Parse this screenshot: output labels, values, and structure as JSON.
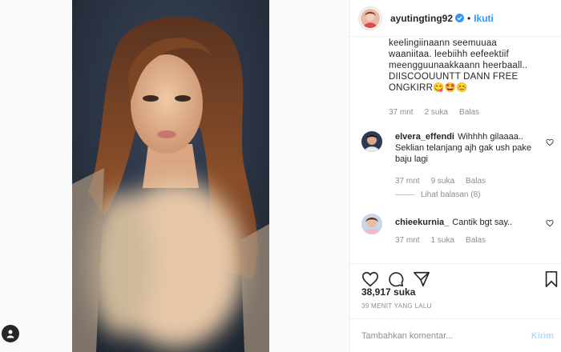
{
  "post": {
    "username": "ayutingting92",
    "follow_label": "Ikuti",
    "dot": "•",
    "caption_lines": [
      "keelingiinaann seemuuaa",
      "waaniitaa. leebiihh eefeektiif",
      "meengguunaakkaann heerbaall..",
      "DIISCOOUUNTT DANN FREE",
      "ONGKIRR😋🤩😊"
    ],
    "caption_meta": {
      "time": "37 mnt",
      "likes": "2 suka",
      "reply": "Balas"
    },
    "likes_count": "38,917 suka",
    "timestamp": "39 MENIT YANG LALU",
    "comment_placeholder": "Tambahkan komentar...",
    "post_button": "Kirim"
  },
  "comments": [
    {
      "user": "elvera_effendi",
      "text": "Wihhhh gilaaaa.. Seklian telanjang ajh gak ush pake baju lagi",
      "time": "37 mnt",
      "likes": "9 suka",
      "reply": "Balas",
      "view_replies": "Lihat balasan (8)"
    },
    {
      "user": "chieekurnia_",
      "text": "Cantik bgt say..",
      "time": "37 mnt",
      "likes": "1 suka",
      "reply": "Balas"
    }
  ],
  "icons": {
    "like": "heart-icon",
    "comment": "comment-icon",
    "share": "share-icon",
    "save": "bookmark-icon",
    "verified": "verified-badge-icon"
  },
  "colors": {
    "link_blue": "#3897f0",
    "muted": "#8e8e8e",
    "border": "#efefef"
  }
}
